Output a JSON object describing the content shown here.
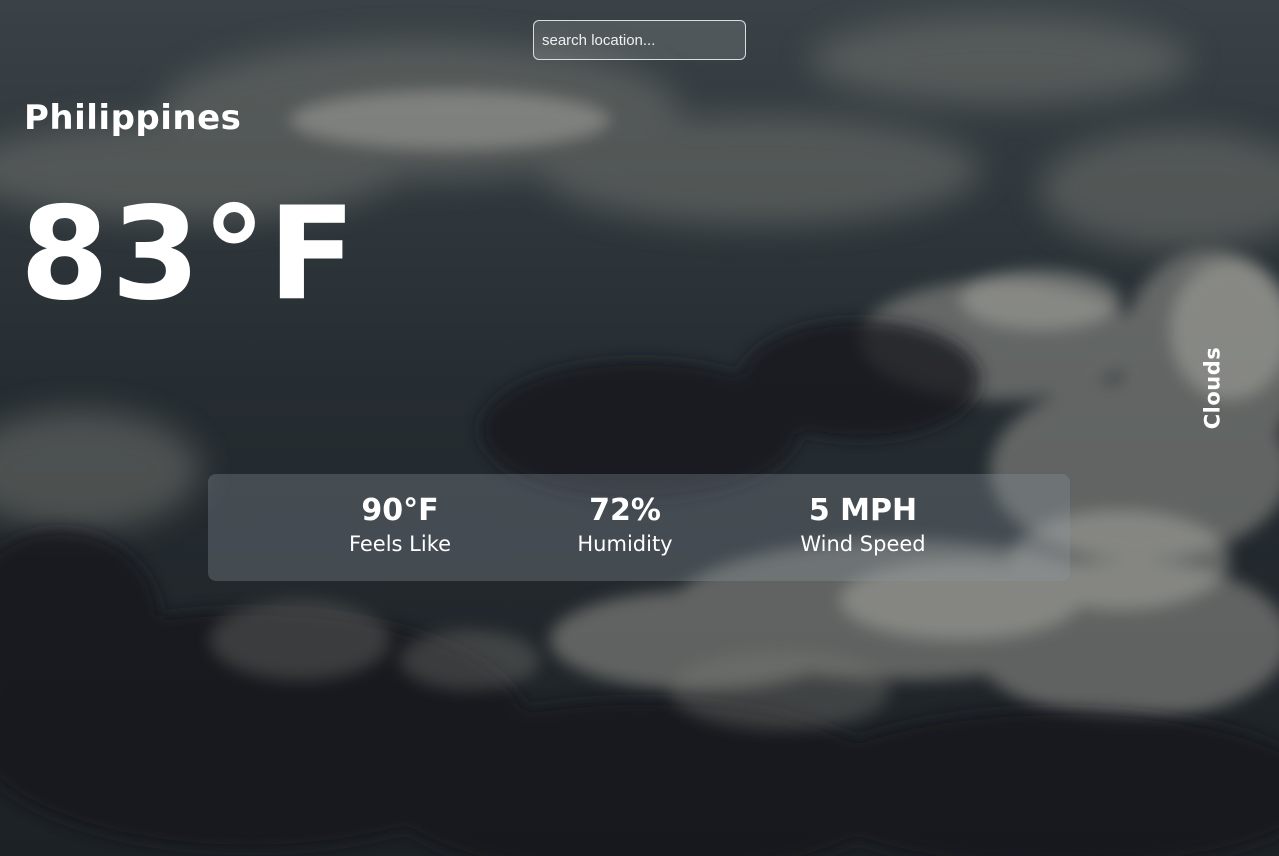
{
  "search": {
    "placeholder": "search location..."
  },
  "weather": {
    "location": "Philippines",
    "temperature": "83°F",
    "condition": "Clouds"
  },
  "stats": {
    "feels_like": {
      "value": "90°F",
      "label": "Feels Like"
    },
    "humidity": {
      "value": "72%",
      "label": "Humidity"
    },
    "wind_speed": {
      "value": "5 MPH",
      "label": "Wind Speed"
    }
  },
  "theme": {
    "background": "#2a3035",
    "text": "#ffffff"
  }
}
